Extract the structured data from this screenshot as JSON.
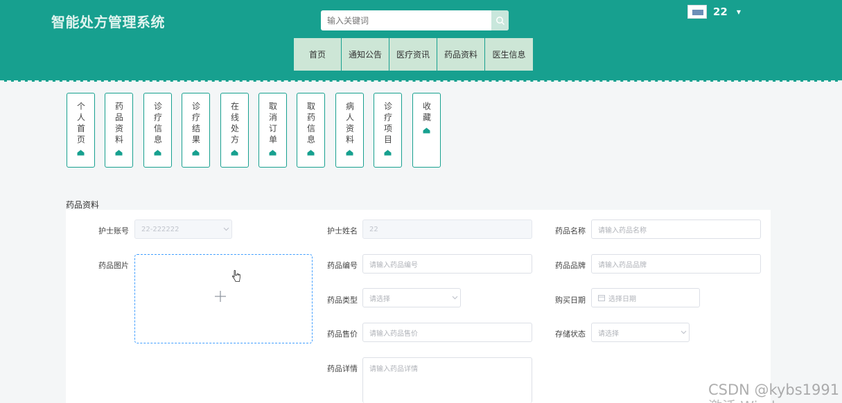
{
  "header": {
    "brand": "智能处方管理系统",
    "search": {
      "placeholder": "输入关键词"
    },
    "user": {
      "name": "22"
    }
  },
  "nav": {
    "items": [
      "首页",
      "通知公告",
      "医疗资讯",
      "药品资料",
      "医生信息"
    ]
  },
  "sidebar_cards": [
    {
      "label": "个人首页"
    },
    {
      "label": "药品资料"
    },
    {
      "label": "诊疗信息"
    },
    {
      "label": "诊疗结果"
    },
    {
      "label": "在线处方"
    },
    {
      "label": "取消订单"
    },
    {
      "label": "取药信息"
    },
    {
      "label": "病人资料"
    },
    {
      "label": "诊疗项目"
    },
    {
      "label": "收藏"
    }
  ],
  "section": {
    "title": "药品资料"
  },
  "form": {
    "nurse_account": {
      "label": "护士账号",
      "value": "22-222222"
    },
    "nurse_name": {
      "label": "护士姓名",
      "value": "22"
    },
    "drug_name": {
      "label": "药品名称",
      "placeholder": "请输入药品名称"
    },
    "drug_image": {
      "label": "药品图片"
    },
    "drug_code": {
      "label": "药品编号",
      "placeholder": "请输入药品编号"
    },
    "drug_brand": {
      "label": "药品品牌",
      "placeholder": "请输入药品品牌"
    },
    "drug_type": {
      "label": "药品类型",
      "placeholder": "请选择"
    },
    "purchase_date": {
      "label": "购买日期",
      "placeholder": "选择日期"
    },
    "drug_price": {
      "label": "药品售价",
      "placeholder": "请输入药品售价"
    },
    "storage_status": {
      "label": "存储状态",
      "placeholder": "请选择"
    },
    "drug_detail": {
      "label": "药品详情",
      "placeholder": "请输入药品详情"
    }
  },
  "watermark": {
    "csdn": "CSDN @kybs1991",
    "activate": "激活 Windows"
  },
  "colors": {
    "header_bg": "#17a08f",
    "nav_bg": "#cde6d6",
    "accent": "#409eff"
  }
}
